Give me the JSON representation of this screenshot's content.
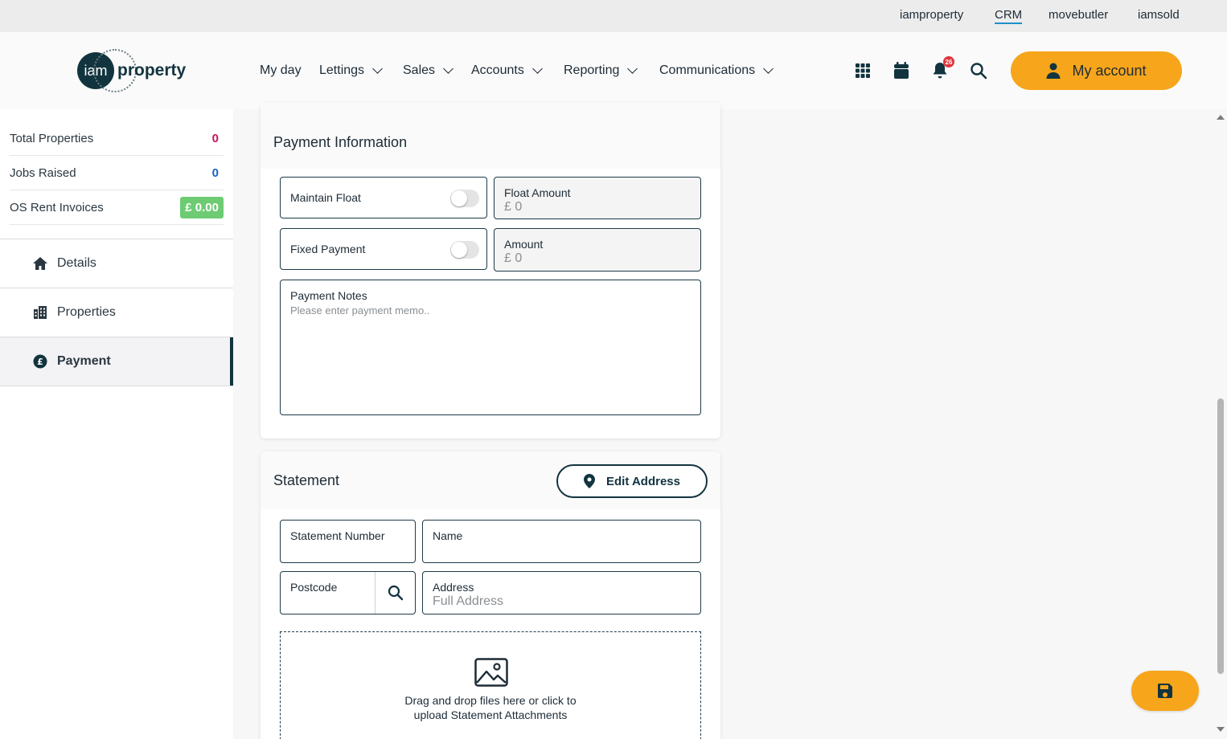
{
  "topbar": {
    "links": [
      "iamproperty",
      "CRM",
      "movebutler",
      "iamsold"
    ],
    "active": "CRM"
  },
  "header": {
    "logo_mark": "iam",
    "logo_word": "property",
    "nav": [
      "My day",
      "Lettings",
      "Sales",
      "Accounts",
      "Reporting",
      "Communications"
    ],
    "notification_count": "26",
    "my_account_label": "My account",
    "accent_color": "#f7a51a"
  },
  "sidebar": {
    "stats": [
      {
        "label": "Total Properties",
        "value": "0",
        "color": "#c2185b"
      },
      {
        "label": "Jobs Raised",
        "value": "0",
        "color": "#1565c0"
      },
      {
        "label": "OS Rent Invoices",
        "value": "£ 0.00",
        "color": "#6dcc73"
      }
    ],
    "items": [
      {
        "label": "Details",
        "icon": "home-icon"
      },
      {
        "label": "Properties",
        "icon": "building-icon"
      },
      {
        "label": "Payment",
        "icon": "pound-coin-icon",
        "active": true
      }
    ]
  },
  "payment": {
    "title": "Payment Information",
    "maintain_float_label": "Maintain Float",
    "maintain_float_on": false,
    "float_amount_label": "Float Amount",
    "float_amount_value": "£ 0",
    "fixed_payment_label": "Fixed Payment",
    "fixed_payment_on": false,
    "amount_label": "Amount",
    "amount_value": "£ 0",
    "notes_label": "Payment Notes",
    "notes_placeholder": "Please enter payment memo.."
  },
  "statement": {
    "title": "Statement",
    "edit_address_label": "Edit Address",
    "statement_number_label": "Statement Number",
    "name_label": "Name",
    "postcode_label": "Postcode",
    "address_label": "Address",
    "address_value": "Full Address",
    "dropzone_line1": "Drag and drop files here or click to",
    "dropzone_line2": "upload Statement Attachments"
  }
}
